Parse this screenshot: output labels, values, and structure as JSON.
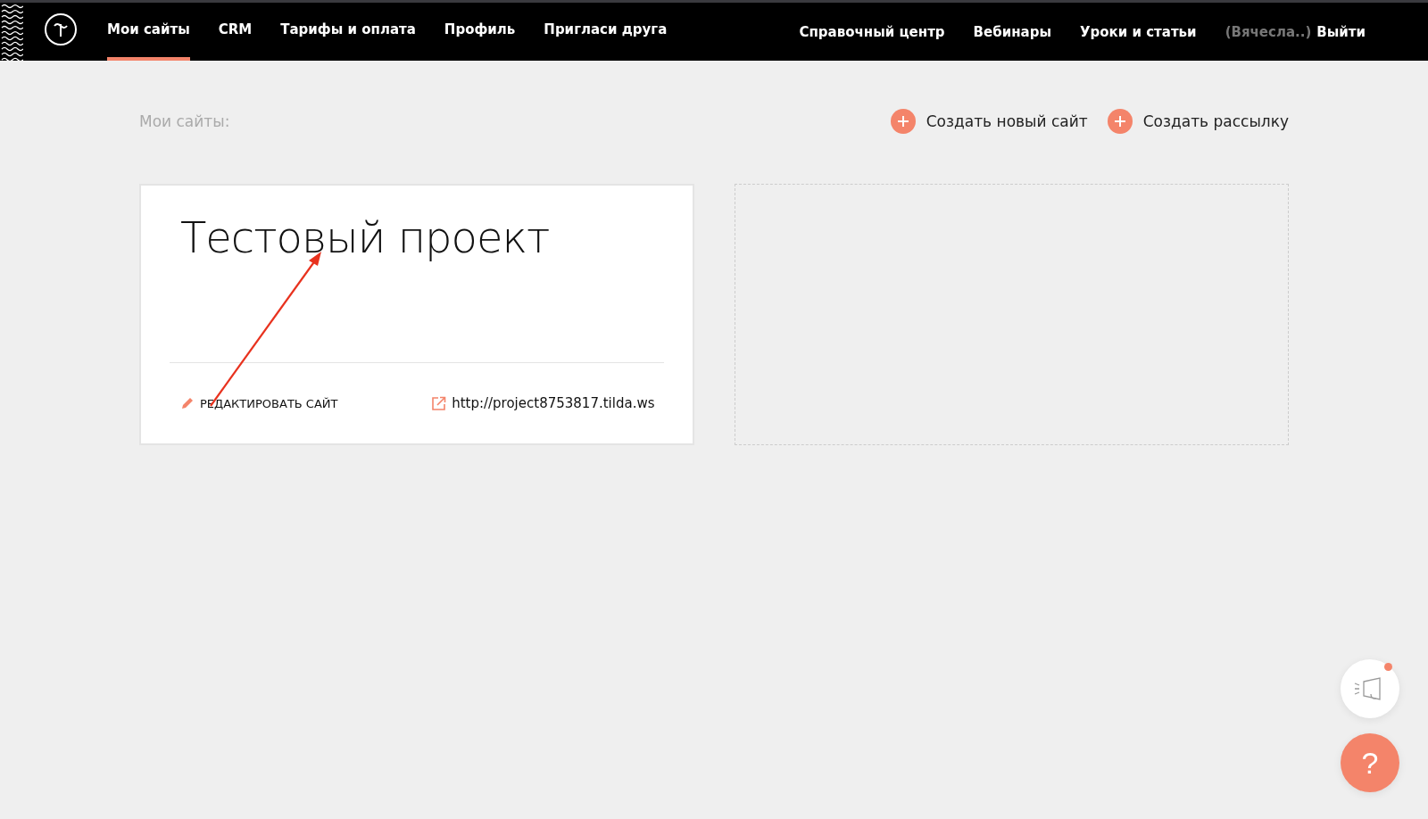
{
  "nav_left": [
    {
      "label": "Мои сайты",
      "selected": true
    },
    {
      "label": "CRM",
      "selected": false
    },
    {
      "label": "Тарифы и оплата",
      "selected": false
    },
    {
      "label": "Профиль",
      "selected": false
    },
    {
      "label": "Пригласи друга",
      "selected": false
    }
  ],
  "nav_right": [
    "Справочный центр",
    "Вебинары",
    "Уроки и статьи"
  ],
  "user": {
    "name": "(Вячесла..)",
    "logout": "Выйти"
  },
  "page_title": "Мои сайты:",
  "actions": [
    "Создать новый сайт",
    "Создать рассылку"
  ],
  "sites": [
    {
      "title": "Тестовый проект",
      "edit": "РЕДАКТИРОВАТЬ САЙТ",
      "url": "http://project8753817.tilda.ws"
    }
  ],
  "announcement": {
    "unread": true
  },
  "help": {
    "label": "?"
  }
}
